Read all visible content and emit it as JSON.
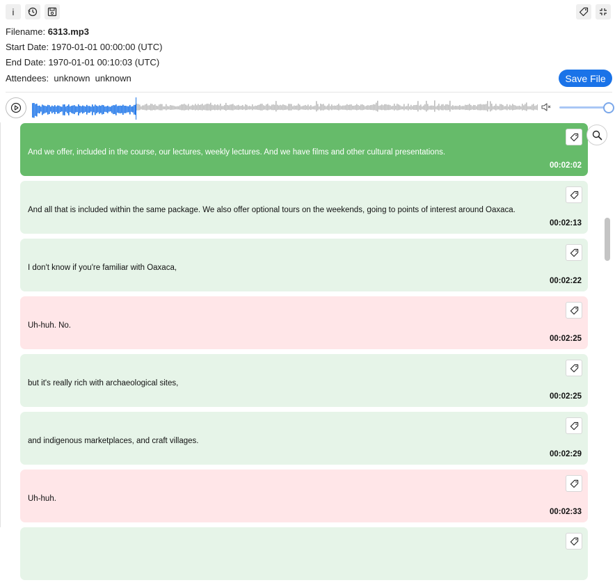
{
  "toolbar": {
    "info_icon": "info-icon",
    "history_icon": "history-icon",
    "save_icon": "floppy-icon",
    "tag_icon": "tag-icon",
    "fullscreen_icon": "collapse-icon",
    "info_glyph": "i"
  },
  "meta": {
    "filename_label": "Filename:",
    "filename_value": "6313.mp3",
    "start_label": "Start Date:",
    "start_value": "1970-01-01 00:00:00 (UTC)",
    "end_label": "End Date:",
    "end_value": "1970-01-01 00:10:03 (UTC)",
    "attendees_label": "Attendees:",
    "attendees": [
      "unknown",
      "unknown"
    ]
  },
  "save_button": "Save File",
  "player": {
    "progress": 0.205,
    "played_color": "#1a73e8",
    "unplayed_color": "#bdbdbd",
    "volume": 1.0
  },
  "segments": [
    {
      "text": "And we offer, included in the course, our lectures, weekly lectures. And we have films and other cultural presentations.",
      "time": "00:02:02",
      "style": "active"
    },
    {
      "text": "And all that is included within the same package. We also offer optional tours on the weekends, going to points of interest around Oaxaca.",
      "time": "00:02:13",
      "style": "green"
    },
    {
      "text": "I don't know if you're familiar with Oaxaca,",
      "time": "00:02:22",
      "style": "green"
    },
    {
      "text": "Uh-huh. No.",
      "time": "00:02:25",
      "style": "pink"
    },
    {
      "text": "but it's really rich with archaeological sites,",
      "time": "00:02:25",
      "style": "green"
    },
    {
      "text": "and indigenous marketplaces, and craft villages.",
      "time": "00:02:29",
      "style": "green"
    },
    {
      "text": "Uh-huh.",
      "time": "00:02:33",
      "style": "pink"
    },
    {
      "text": "",
      "time": "",
      "style": "green"
    }
  ],
  "colors": {
    "active": "#66bb6a",
    "speaker_a": "#e6f4e8",
    "speaker_b": "#ffe6e8",
    "accent": "#1a73e8"
  }
}
